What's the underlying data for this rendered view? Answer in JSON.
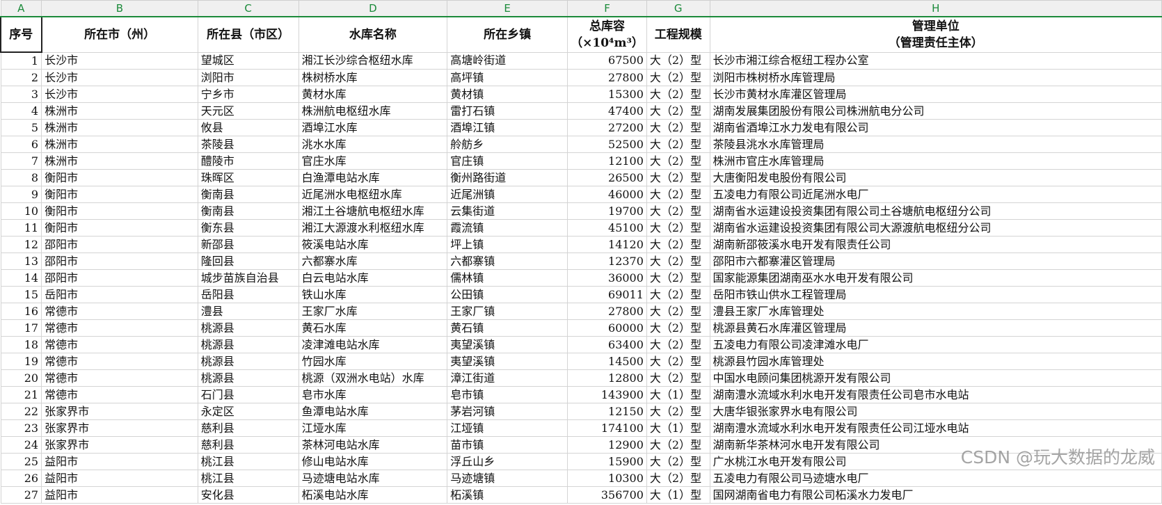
{
  "columns": [
    "A",
    "B",
    "C",
    "D",
    "E",
    "F",
    "G",
    "H"
  ],
  "headers": {
    "seq": "序号",
    "city": "所在市（州）",
    "county": "所在县（市区）",
    "reservoir": "水库名称",
    "town": "所在乡镇",
    "capacity_line1": "总库容",
    "capacity_line2": "（×10⁴m³）",
    "scale": "工程规模",
    "unit_line1": "管理单位",
    "unit_line2": "（管理责任主体）"
  },
  "rows": [
    [
      "1",
      "长沙市",
      "望城区",
      "湘江长沙综合枢纽水库",
      "高塘岭街道",
      "67500",
      "大（2）型",
      "长沙市湘江综合枢纽工程办公室"
    ],
    [
      "2",
      "长沙市",
      "浏阳市",
      "株树桥水库",
      "高坪镇",
      "27800",
      "大（2）型",
      "浏阳市株树桥水库管理局"
    ],
    [
      "3",
      "长沙市",
      "宁乡市",
      "黄材水库",
      "黄材镇",
      "15300",
      "大（2）型",
      "长沙市黄材水库灌区管理局"
    ],
    [
      "4",
      "株洲市",
      "天元区",
      "株洲航电枢纽水库",
      "雷打石镇",
      "47400",
      "大（2）型",
      "湖南发展集团股份有限公司株洲航电分公司"
    ],
    [
      "5",
      "株洲市",
      "攸县",
      "酒埠江水库",
      "酒埠江镇",
      "27200",
      "大（2）型",
      "湖南省酒埠江水力发电有限公司"
    ],
    [
      "6",
      "株洲市",
      "茶陵县",
      "洮水水库",
      "舲舫乡",
      "52500",
      "大（2）型",
      "茶陵县洮水水库管理局"
    ],
    [
      "7",
      "株洲市",
      "醴陵市",
      "官庄水库",
      "官庄镇",
      "12100",
      "大（2）型",
      "株洲市官庄水库管理局"
    ],
    [
      "8",
      "衡阳市",
      "珠晖区",
      "白渔潭电站水库",
      "衡州路街道",
      "26500",
      "大（2）型",
      "大唐衡阳发电股份有限公司"
    ],
    [
      "9",
      "衡阳市",
      "衡南县",
      "近尾洲水电枢纽水库",
      "近尾洲镇",
      "46000",
      "大（2）型",
      "五凌电力有限公司近尾洲水电厂"
    ],
    [
      "10",
      "衡阳市",
      "衡南县",
      "湘江土谷塘航电枢纽水库",
      "云集街道",
      "19700",
      "大（2）型",
      "湖南省水运建设投资集团有限公司土谷塘航电枢纽分公司"
    ],
    [
      "11",
      "衡阳市",
      "衡东县",
      "湘江大源渡水利枢纽水库",
      "霞流镇",
      "45100",
      "大（2）型",
      "湖南省水运建设投资集团有限公司大源渡航电枢纽分公司"
    ],
    [
      "12",
      "邵阳市",
      "新邵县",
      "筱溪电站水库",
      "坪上镇",
      "14120",
      "大（2）型",
      "湖南新邵筱溪水电开发有限责任公司"
    ],
    [
      "13",
      "邵阳市",
      "隆回县",
      "六都寨水库",
      "六都寨镇",
      "12370",
      "大（2）型",
      "邵阳市六都寨灌区管理局"
    ],
    [
      "14",
      "邵阳市",
      "城步苗族自治县",
      "白云电站水库",
      "儒林镇",
      "36000",
      "大（2）型",
      "国家能源集团湖南巫水水电开发有限公司"
    ],
    [
      "15",
      "岳阳市",
      "岳阳县",
      "铁山水库",
      "公田镇",
      "69011",
      "大（2）型",
      "岳阳市铁山供水工程管理局"
    ],
    [
      "16",
      "常德市",
      "澧县",
      "王家厂水库",
      "王家厂镇",
      "27800",
      "大（2）型",
      "澧县王家厂水库管理处"
    ],
    [
      "17",
      "常德市",
      "桃源县",
      "黄石水库",
      "黄石镇",
      "60000",
      "大（2）型",
      "桃源县黄石水库灌区管理局"
    ],
    [
      "18",
      "常德市",
      "桃源县",
      "凌津滩电站水库",
      "夷望溪镇",
      "63400",
      "大（2）型",
      "五凌电力有限公司凌津滩水电厂"
    ],
    [
      "19",
      "常德市",
      "桃源县",
      "竹园水库",
      "夷望溪镇",
      "14500",
      "大（2）型",
      "桃源县竹园水库管理处"
    ],
    [
      "20",
      "常德市",
      "桃源县",
      "桃源（双洲水电站）水库",
      "漳江街道",
      "12800",
      "大（2）型",
      "中国水电顾问集团桃源开发有限公司"
    ],
    [
      "21",
      "常德市",
      "石门县",
      "皂市水库",
      "皂市镇",
      "143900",
      "大（1）型",
      "湖南澧水流域水利水电开发有限责任公司皂市水电站"
    ],
    [
      "22",
      "张家界市",
      "永定区",
      "鱼潭电站水库",
      "茅岩河镇",
      "12150",
      "大（2）型",
      "大唐华银张家界水电有限公司"
    ],
    [
      "23",
      "张家界市",
      "慈利县",
      "江垭水库",
      "江垭镇",
      "174100",
      "大（1）型",
      "湖南澧水流域水利水电开发有限责任公司江垭水电站"
    ],
    [
      "24",
      "张家界市",
      "慈利县",
      "茶林河电站水库",
      "苗市镇",
      "12900",
      "大（2）型",
      "湖南新华茶林河水电开发有限公司"
    ],
    [
      "25",
      "益阳市",
      "桃江县",
      "修山电站水库",
      "浮丘山乡",
      "15900",
      "大（2）型",
      "广水桃江水电开发有限公司"
    ],
    [
      "26",
      "益阳市",
      "桃江县",
      "马迹塘电站水库",
      "马迹塘镇",
      "10300",
      "大（2）型",
      "五凌电力有限公司马迹塘水电厂"
    ],
    [
      "27",
      "益阳市",
      "安化县",
      "柘溪电站水库",
      "柘溪镇",
      "356700",
      "大（1）型",
      "国网湖南省电力有限公司柘溪水力发电厂"
    ]
  ],
  "watermark": "CSDN @玩大数据的龙威"
}
